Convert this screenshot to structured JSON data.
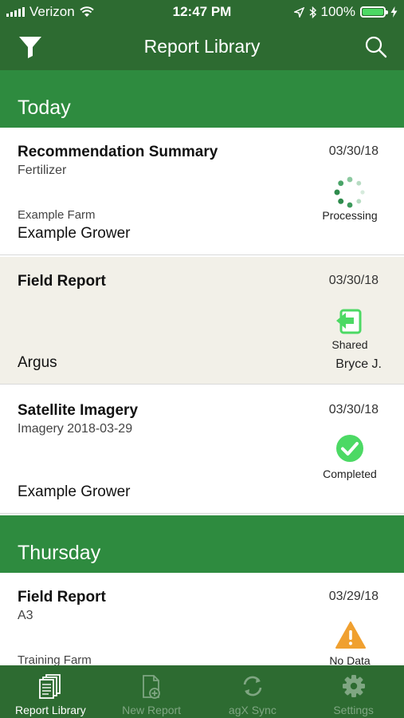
{
  "status_bar": {
    "carrier": "Verizon",
    "time": "12:47 PM",
    "battery": "100%",
    "icons": [
      "signal-icon",
      "wifi-icon",
      "location-icon",
      "bluetooth-icon",
      "battery-icon",
      "charging-icon"
    ]
  },
  "nav": {
    "title": "Report Library",
    "left_icon": "filter-icon",
    "right_icon": "search-icon"
  },
  "sections": [
    {
      "header": "Today"
    },
    {
      "header": "Thursday"
    }
  ],
  "reports": [
    {
      "title": "Recommendation Summary",
      "subtitle": "Fertilizer",
      "farm": "Example Farm",
      "grower": "Example Grower",
      "date": "03/30/18",
      "status": "Processing",
      "status_icon": "spinner-icon"
    },
    {
      "title": "Field Report",
      "subtitle": "",
      "farm": "",
      "grower": "Argus",
      "date": "03/30/18",
      "status": "Shared",
      "status_icon": "shared-icon",
      "shared_by": "Bryce J."
    },
    {
      "title": "Satellite Imagery",
      "subtitle": "Imagery 2018-03-29",
      "farm": "",
      "grower": "Example Grower",
      "date": "03/30/18",
      "status": "Completed",
      "status_icon": "check-circle-icon"
    },
    {
      "title": "Field Report",
      "subtitle": "A3",
      "farm": "Training Farm",
      "grower": "",
      "date": "03/29/18",
      "status": "No Data",
      "status_icon": "warning-icon"
    }
  ],
  "tabs": [
    {
      "label": "Report Library",
      "icon": "report-library-icon",
      "active": true
    },
    {
      "label": "New Report",
      "icon": "new-report-icon",
      "active": false
    },
    {
      "label": "agX Sync",
      "icon": "sync-icon",
      "active": false
    },
    {
      "label": "Settings",
      "icon": "gear-icon",
      "active": false
    }
  ],
  "colors": {
    "nav_green": "#2d6b31",
    "section_green": "#2e8b3f",
    "status_green": "#4cd964",
    "warning_orange": "#f0a030",
    "highlight_row": "#f2f0e8"
  }
}
